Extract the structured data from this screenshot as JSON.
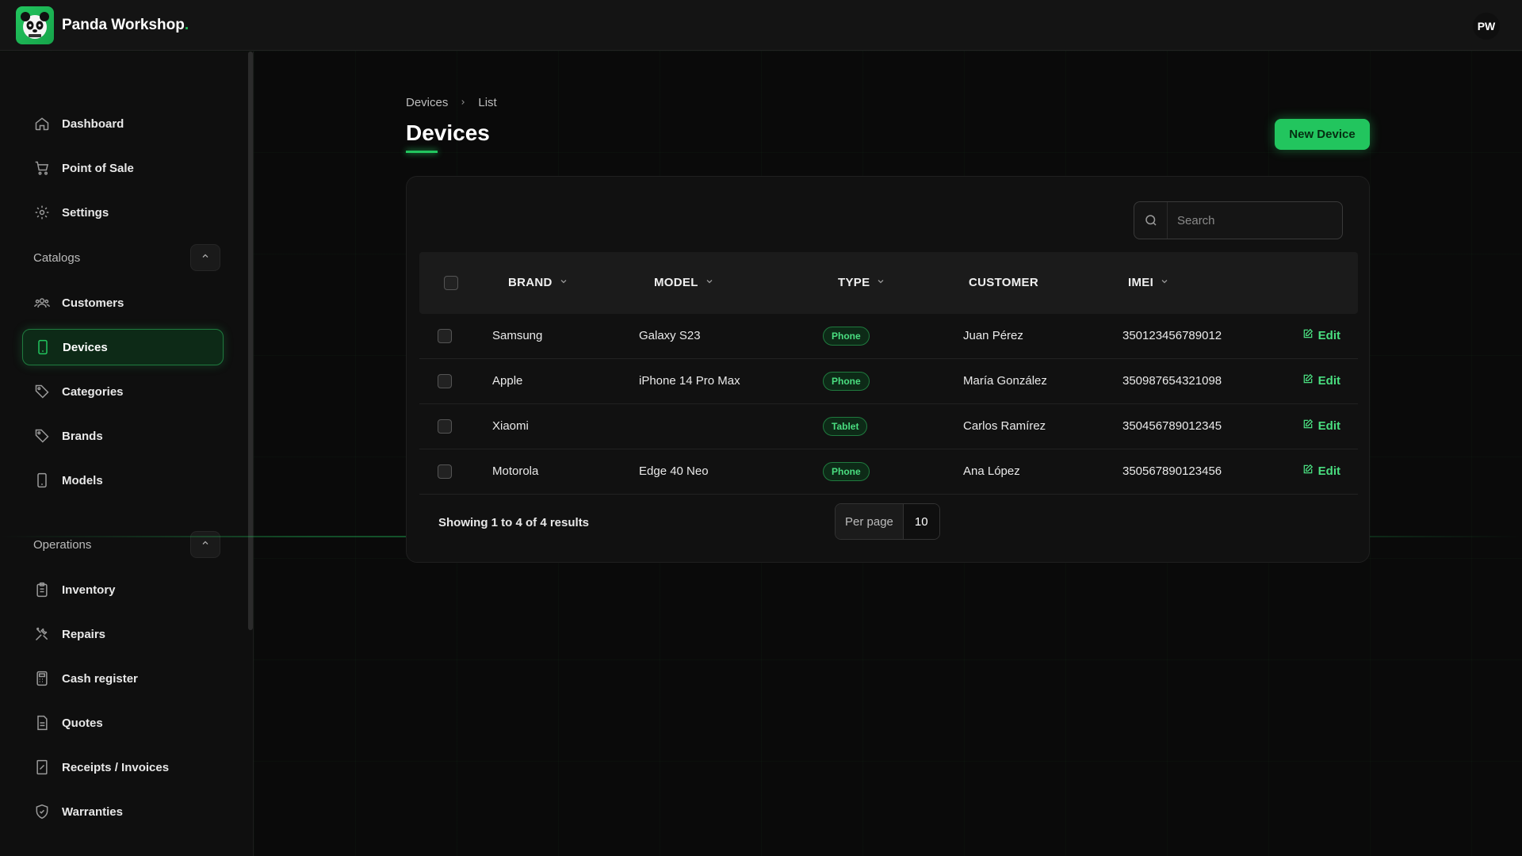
{
  "app": {
    "name": "Panda Workshop",
    "dot": ".",
    "avatar_initials": "PW"
  },
  "sidebar": {
    "top_items": [
      {
        "label": "Dashboard",
        "icon": "home-icon"
      },
      {
        "label": "Point of Sale",
        "icon": "cart-icon"
      },
      {
        "label": "Settings",
        "icon": "gear-icon"
      }
    ],
    "catalogs": {
      "label": "Catalogs",
      "items": [
        {
          "label": "Customers",
          "icon": "users-icon"
        },
        {
          "label": "Devices",
          "icon": "phone-icon",
          "active": true
        },
        {
          "label": "Categories",
          "icon": "tag-icon"
        },
        {
          "label": "Brands",
          "icon": "tag-icon"
        },
        {
          "label": "Models",
          "icon": "phone-icon"
        }
      ]
    },
    "operations": {
      "label": "Operations",
      "items": [
        {
          "label": "Inventory",
          "icon": "clipboard-icon"
        },
        {
          "label": "Repairs",
          "icon": "tools-icon"
        },
        {
          "label": "Cash register",
          "icon": "calculator-icon"
        },
        {
          "label": "Quotes",
          "icon": "document-icon"
        },
        {
          "label": "Receipts / Invoices",
          "icon": "receipt-icon"
        },
        {
          "label": "Warranties",
          "icon": "shield-icon"
        }
      ]
    }
  },
  "breadcrumb": {
    "parent": "Devices",
    "current": "List"
  },
  "page": {
    "title": "Devices",
    "new_button": "New Device"
  },
  "search": {
    "placeholder": "Search"
  },
  "table": {
    "columns": {
      "brand": "BRAND",
      "model": "MODEL",
      "type": "TYPE",
      "customer": "CUSTOMER",
      "imei": "IMEI"
    },
    "edit_label": "Edit",
    "rows": [
      {
        "brand": "Samsung",
        "model": "Galaxy S23",
        "type": "Phone",
        "customer": "Juan Pérez",
        "imei": "350123456789012"
      },
      {
        "brand": "Apple",
        "model": "iPhone 14 Pro Max",
        "type": "Phone",
        "customer": "María González",
        "imei": "350987654321098"
      },
      {
        "brand": "Xiaomi",
        "model": "",
        "type": "Tablet",
        "customer": "Carlos Ramírez",
        "imei": "350456789012345"
      },
      {
        "brand": "Motorola",
        "model": "Edge 40 Neo",
        "type": "Phone",
        "customer": "Ana López",
        "imei": "350567890123456"
      }
    ]
  },
  "pagination": {
    "summary": "Showing 1 to 4 of 4 results",
    "per_page_label": "Per page",
    "per_page_value": "10"
  },
  "colors": {
    "accent": "#22c55e",
    "background": "#0a0a0a"
  }
}
